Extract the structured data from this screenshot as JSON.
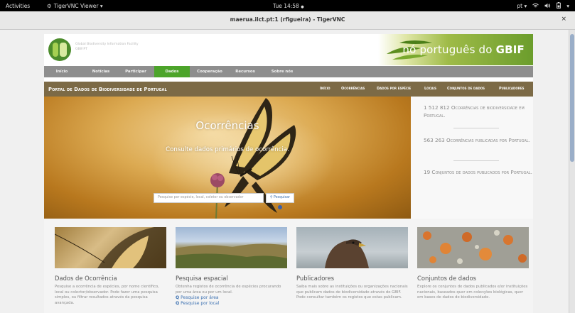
{
  "topbar": {
    "activities": "Activities",
    "app_name": "TigerVNC Viewer",
    "app_menu_arrow": "▾",
    "clock": "Tue 14:58",
    "clock_dot": "●",
    "keyboard_layout": "pt",
    "layout_arrow": "▾"
  },
  "window": {
    "title": "maerua.ilct.pt:1 (rfigueira) - TigerVNC",
    "close_glyph": "×"
  },
  "gbif": {
    "facility_line1": "Global Biodiversity Information Facility",
    "facility_line2": "GBIF.PT",
    "banner_text_light": "nó português do ",
    "banner_text_bold": "GBIF",
    "nav": [
      {
        "label": "Início"
      },
      {
        "label": "Notícias"
      },
      {
        "label": "Participar"
      },
      {
        "label": "Dados",
        "active": true
      },
      {
        "label": "Cooperação"
      },
      {
        "label": "Recursos"
      },
      {
        "label": "Sobre nós"
      }
    ]
  },
  "portal": {
    "title": "Portal de Dados de Biodiversidade de Portugal",
    "nav": [
      "Início",
      "Ocorrências",
      "Dados por espécie",
      "Locais",
      "Conjuntos de dados",
      "Publicadores"
    ]
  },
  "hero": {
    "title": "Ocorrências",
    "subtitle": "Consulte dados primários de ocorrência.",
    "search_placeholder": "Pesquise por espécie, local, coletor ou observador",
    "search_button": "Pesquisar"
  },
  "stats": [
    {
      "text": "1 512 812 Ocorrências de biodiversidade em Portugal."
    },
    {
      "text": "563 263 Ocorrências publicadas por Portugal."
    },
    {
      "text": "19 Conjuntos de dados publicados por Portugal."
    }
  ],
  "cards": [
    {
      "title": "Dados de Ocorrência",
      "desc": "Pesquise a ocorrência de espécies, por nome científico, local ou colector/observador. Pode fazer uma pesquisa simples, ou filtrar resultados através da pesquisa avançada.",
      "links": []
    },
    {
      "title": "Pesquisa espacial",
      "desc": "Obtenha registos de ocorrência de espécies procurando por uma área ou por um local.",
      "links": [
        "Pesquise por área",
        "Pesquise por local"
      ]
    },
    {
      "title": "Publicadores",
      "desc": "Saiba mais sobre as instituições ou organizações nacionais que publicam dados de biodiversidade através do GBIF. Pode consultar também os registos que estas publicam.",
      "links": []
    },
    {
      "title": "Conjuntos de dados",
      "desc": "Explore os conjuntos de dados publicados e/or instituições nacionais, baseados quer em colecções biológicas, quer em bases de dados de biodiversidade.",
      "links": []
    }
  ],
  "colors": {
    "gbif_green": "#4ca42a",
    "portal_bar": "#7c6a46",
    "link_blue": "#3a6fb0"
  },
  "icons": {
    "app_icon": "gear-icon",
    "search_icon": "magnifier-icon",
    "volume_icon": "speaker-icon",
    "network_icon": "network-icon",
    "battery_icon": "battery-icon",
    "close_icon": "close-icon"
  }
}
